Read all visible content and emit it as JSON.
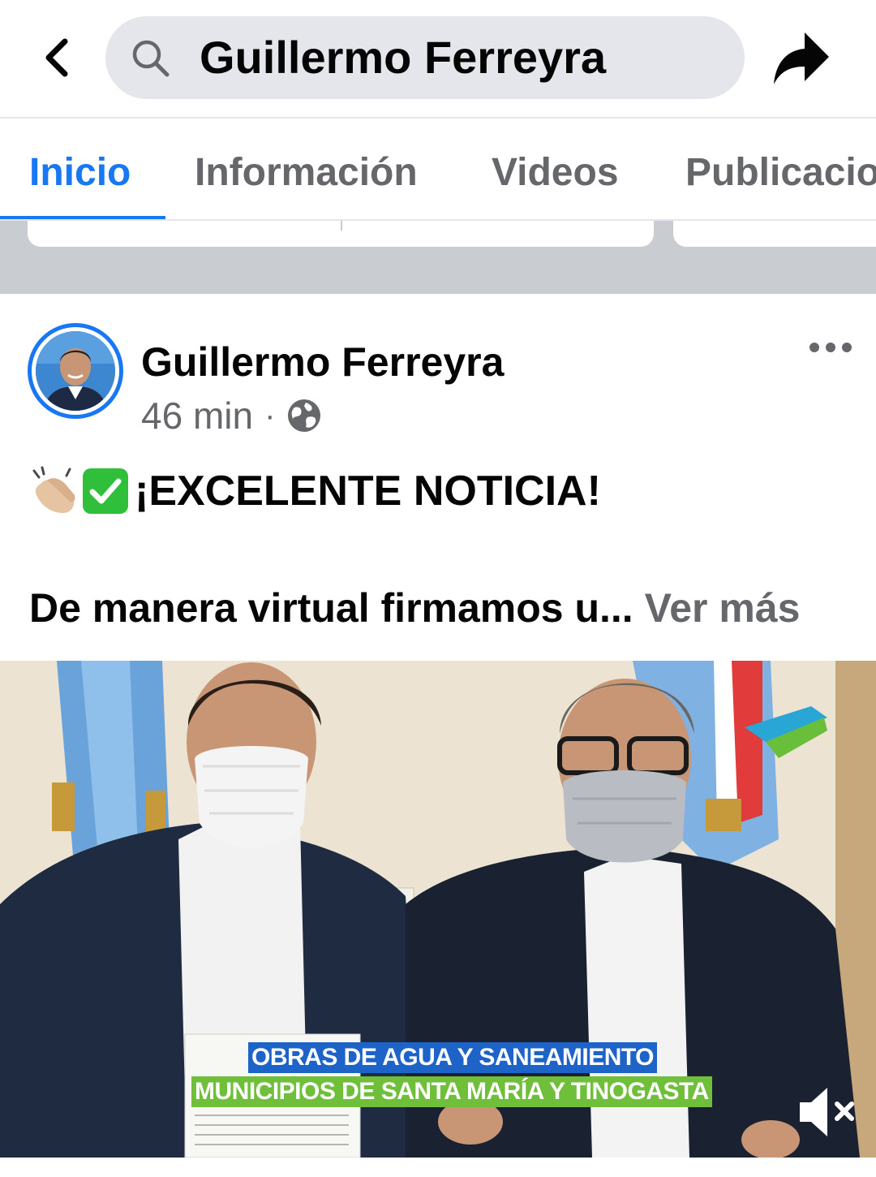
{
  "topbar": {
    "search_query": "Guillermo Ferreyra"
  },
  "tabs": [
    {
      "label": "Inicio",
      "active": true
    },
    {
      "label": "Información",
      "active": false
    },
    {
      "label": "Videos",
      "active": false
    },
    {
      "label": "Publicacio",
      "active": false
    }
  ],
  "post": {
    "author": "Guillermo Ferreyra",
    "time": "46 min",
    "separator": "·",
    "headline": "¡EXCELENTE NOTICIA!",
    "body_preview": "De manera virtual firmamos u...",
    "see_more": "Ver más",
    "video": {
      "caption_line1": "OBRAS DE AGUA Y SANEAMIENTO",
      "caption_line2": "MUNICIPIOS DE SANTA MARÍA Y TINOGASTA"
    }
  },
  "colors": {
    "accent": "#1877f2",
    "caption_blue": "#1e64c8",
    "caption_green": "#6fbf3a",
    "secondary_text": "#65676b"
  },
  "icons": [
    "back-arrow-icon",
    "search-icon",
    "share-icon",
    "more-icon",
    "globe-icon",
    "clapping-hands-icon",
    "check-mark-icon",
    "mute-icon"
  ]
}
